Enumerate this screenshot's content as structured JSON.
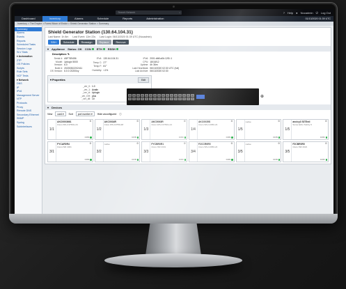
{
  "topbar": {
    "search_placeholder": "Search Network",
    "help": "Help",
    "user": "Nocadmin",
    "logout": "Log Out"
  },
  "nav": {
    "items": [
      "Dashboard",
      "Inventory",
      "Alarms",
      "Schedule",
      "Reports",
      "Administration"
    ],
    "active_index": 1,
    "clock": "01/13/2020 01:39 UTC"
  },
  "breadcrumb": "Inventory > The Empire > Forest Moon of Endor > Shield Generator Station > Summary",
  "sidebar": {
    "items": [
      {
        "label": "Summary",
        "type": "selected"
      },
      {
        "label": "Alarms",
        "type": "item"
      },
      {
        "label": "Events",
        "type": "item"
      },
      {
        "label": "Reports",
        "type": "item"
      },
      {
        "label": "Scheduled Tasks",
        "type": "item"
      },
      {
        "label": "Session Logs",
        "type": "item"
      },
      {
        "label": "SLV Stats",
        "type": "item"
      },
      {
        "label": "▾ Automation",
        "type": "section"
      },
      {
        "label": "ZTP",
        "type": "item"
      },
      {
        "label": "OS Policies",
        "type": "item"
      },
      {
        "label": "Scripts",
        "type": "item"
      },
      {
        "label": "Rule Sets",
        "type": "item"
      },
      {
        "label": "NCF Tests",
        "type": "item"
      },
      {
        "label": "▾ Network",
        "type": "section"
      },
      {
        "label": "DNS",
        "type": "item"
      },
      {
        "label": "IP",
        "type": "item"
      },
      {
        "label": "IPv6",
        "type": "item"
      },
      {
        "label": "Management Server",
        "type": "item"
      },
      {
        "label": "NTP",
        "type": "item"
      },
      {
        "label": "Protocols",
        "type": "item"
      },
      {
        "label": "Proxy",
        "type": "item"
      },
      {
        "label": "Remote DNS",
        "type": "item"
      },
      {
        "label": "Secondary Ethernet",
        "type": "item"
      },
      {
        "label": "SNMP",
        "type": "item"
      },
      {
        "label": "Syslog",
        "type": "item"
      },
      {
        "label": "Subinterfaces",
        "type": "item"
      }
    ]
  },
  "header": {
    "title": "Shield Generator Station (130.64.104.31)",
    "last_name": "Last Name:  1h 8m",
    "last_event": "Last Event:  12m 22s",
    "last_login": "Last Login:  06/13/2020 01:39 UTC (Nocadmin)",
    "buttons": [
      {
        "label": "SSH",
        "style": "blue"
      },
      {
        "label": "Schedule",
        "style": "dark"
      },
      {
        "label": "Reassign",
        "style": "dark"
      },
      {
        "label": "Replace",
        "style": "gray"
      },
      {
        "label": "Remove",
        "style": "dark"
      }
    ]
  },
  "appliance": {
    "label": "Appliance",
    "status_label": "Status: OK",
    "con_label": "CON",
    "eth_label": "ETH",
    "rssh_label": "RSSH",
    "description_label": "Description:",
    "col1": [
      {
        "k": "Serial #:",
        "v": "A5F789456"
      },
      {
        "k": "Model:",
        "v": "Uplogix 5000"
      },
      {
        "k": "Version:",
        "v": "6.0"
      },
      {
        "k": "Build #:",
        "v": "20200302202411"
      },
      {
        "k": "OS Version:",
        "v": "6.0.0 20200xy"
      }
    ],
    "col2": [
      {
        "k": "IPv4:",
        "v": "130.64.104.31"
      },
      {
        "k": "Temp C:",
        "v": "27°"
      },
      {
        "k": "Temp F:",
        "v": "81°"
      },
      {
        "k": "Humidity:",
        "v": "<1%"
      }
    ],
    "col3": [
      {
        "k": "IPv6:",
        "v": "2001:db8:a0b:12f0::1"
      },
      {
        "k": "CPU:",
        "v": "18/18/12"
      },
      {
        "k": "Uptime:",
        "v": "4h 36m"
      },
      {
        "k": "Last Heartbeat:",
        "v": "06/13/2020 02:30 UTC (full)"
      },
      {
        "k": "Last Archive:",
        "v": "06/13/2020 02:30"
      }
    ]
  },
  "properties": {
    "label": "▾ Properties",
    "edit_label": "Edit",
    "rows": [
      {
        "k": "_ver_0:",
        "v": "1.0"
      },
      {
        "k": "_ver_1:",
        "v": "Avatin"
      },
      {
        "k": "_ver_cl:",
        "v": "Uplogix"
      },
      {
        "k": "_ver_GH:",
        "v": "plus"
      },
      {
        "k": "_ver_dil:",
        "v": "10"
      }
    ]
  },
  "devices": {
    "label": "Devices",
    "view_label": "View",
    "view_value": "card ▾",
    "sort_label": "Sort",
    "sort_value": "port number ▾",
    "unconfig_label": "Hide unconfigured",
    "tiles": [
      {
        "slot": "1/1",
        "name": "AKC0003661",
        "model": "Cisco WS-C3750G-24",
        "status": "CON"
      },
      {
        "slot": "1/2",
        "name": "AKC0034R",
        "model": "Cisco WS-C3750-48",
        "status": "CON"
      },
      {
        "slot": "1/3",
        "name": "AKC0063R",
        "model": "Cisco WS-C3750G-24",
        "status": "CON"
      },
      {
        "slot": "1/4",
        "name": "AKC0035S",
        "model": "Cisco WS-C2950-24",
        "status": "CON"
      },
      {
        "slot": "1/5",
        "name": "",
        "model": "native",
        "status": "CON"
      },
      {
        "slot": "1/5",
        "name": "ancicy3 52T8nil",
        "model": "Some Echo Telnby 9",
        "status": "CON"
      },
      {
        "slot": "3/1",
        "name": "FYCAR0R4",
        "model": "Cisco ISR 4321",
        "status": "CON"
      },
      {
        "slot": "3/2",
        "name": "",
        "model": "native",
        "status": "CON"
      },
      {
        "slot": "3/3",
        "name": "FYCBR0R1",
        "model": "Cisco ISR 4331",
        "status": "CON"
      },
      {
        "slot": "3/4",
        "name": "F2CCR0R5",
        "model": "Cisco WS-C2950-24",
        "status": "CON"
      },
      {
        "slot": "3/5",
        "name": "",
        "model": "native",
        "status": "CON"
      },
      {
        "slot": "3/5",
        "name": "F2CBR0R0",
        "model": "Cisco ISR 4321",
        "status": "CON"
      }
    ]
  },
  "colors": {
    "accent": "#2f7bd6",
    "ok": "#2bb24c",
    "navbar": "#1e2530"
  }
}
